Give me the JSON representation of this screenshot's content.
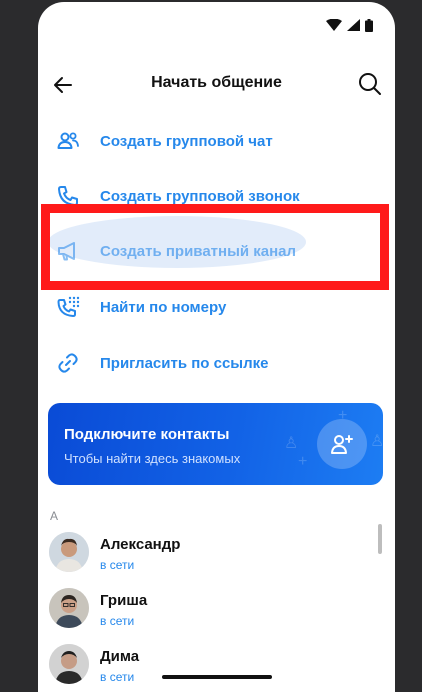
{
  "header": {
    "title": "Начать общение",
    "back_icon": "arrow-left-icon",
    "search_icon": "search-icon"
  },
  "status_bar": {
    "icons": [
      "wifi-icon",
      "signal-icon",
      "battery-icon"
    ]
  },
  "menu": [
    {
      "label": "Создать групповой чат",
      "icon": "users-icon"
    },
    {
      "label": "Создать групповой звонок",
      "icon": "phone-icon"
    },
    {
      "label": "Создать приватный канал",
      "icon": "megaphone-icon"
    },
    {
      "label": "Найти по номеру",
      "icon": "phone-keypad-icon"
    },
    {
      "label": "Пригласить по ссылке",
      "icon": "link-icon"
    }
  ],
  "banner": {
    "title": "Подключите контакты",
    "subtitle": "Чтобы найти здесь знакомых",
    "icon": "add-user-icon"
  },
  "contacts": {
    "section_letter": "А",
    "items": [
      {
        "name": "Александр",
        "status": "в сети"
      },
      {
        "name": "Гриша",
        "status": "в сети"
      },
      {
        "name": "Дима",
        "status": "в сети"
      }
    ]
  },
  "colors": {
    "accent": "#2688eb",
    "highlight": "#ff1a1a",
    "banner": "#0a4bd6"
  }
}
